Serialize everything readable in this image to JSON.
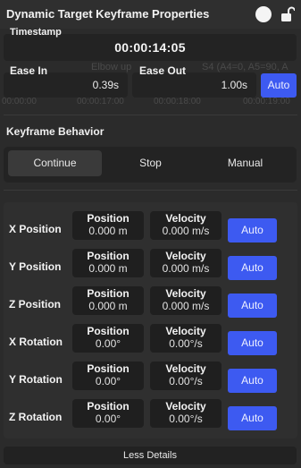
{
  "window": {
    "title": "Dynamic Target Keyframe Properties"
  },
  "background_timeline": {
    "text_a": "Elbow up",
    "text_b": "S4 (A4=0, A5=90, A",
    "ticks": [
      "00:00:00",
      "00:00:17:00",
      "00:00:18:00",
      "00:00:19:00"
    ]
  },
  "timestamp": {
    "label": "Timestamp",
    "value": "00:00:14:05"
  },
  "ease": {
    "in_label": "Ease In",
    "in_value": "0.39s",
    "out_label": "Ease Out",
    "out_value": "1.00s",
    "auto_label": "Auto"
  },
  "keyframe_behavior": {
    "label": "Keyframe Behavior",
    "options": [
      "Continue",
      "Stop",
      "Manual"
    ],
    "selected": "Continue"
  },
  "rows": [
    {
      "label": "X Position",
      "pos_header": "Position",
      "pos_value": "0.000 m",
      "vel_header": "Velocity",
      "vel_value": "0.000 m/s",
      "auto": "Auto"
    },
    {
      "label": "Y Position",
      "pos_header": "Position",
      "pos_value": "0.000 m",
      "vel_header": "Velocity",
      "vel_value": "0.000 m/s",
      "auto": "Auto"
    },
    {
      "label": "Z Position",
      "pos_header": "Position",
      "pos_value": "0.000 m",
      "vel_header": "Velocity",
      "vel_value": "0.000 m/s",
      "auto": "Auto"
    },
    {
      "label": "X Rotation",
      "pos_header": "Position",
      "pos_value": "0.00°",
      "vel_header": "Velocity",
      "vel_value": "0.00°/s",
      "auto": "Auto"
    },
    {
      "label": "Y Rotation",
      "pos_header": "Position",
      "pos_value": "0.00°",
      "vel_header": "Velocity",
      "vel_value": "0.00°/s",
      "auto": "Auto"
    },
    {
      "label": "Z Rotation",
      "pos_header": "Position",
      "pos_value": "0.00°",
      "vel_header": "Velocity",
      "vel_value": "0.00°/s",
      "auto": "Auto"
    }
  ],
  "less_details": "Less Details",
  "colors": {
    "accent": "#3d5af1",
    "background": "#2b2b2b",
    "field": "#1f1f1f"
  }
}
